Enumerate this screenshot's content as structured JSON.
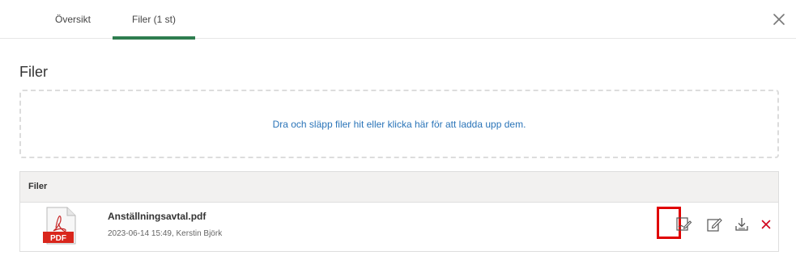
{
  "tabs": [
    {
      "label": "Översikt",
      "active": false
    },
    {
      "label": "Filer (1 st)",
      "active": true
    }
  ],
  "section": {
    "title": "Filer"
  },
  "dropzone": {
    "text": "Dra och släpp filer hit eller klicka här för att ladda upp dem."
  },
  "table": {
    "header": "Filer",
    "files": [
      {
        "name": "Anställningsavtal.pdf",
        "meta": "2023-06-14 15:49, Kerstin Björk",
        "type_badge": "PDF"
      }
    ]
  },
  "icons": {
    "close": "close-icon",
    "file": "pdf-file-icon",
    "sign": "sign-document-icon",
    "edit": "edit-icon",
    "download": "download-icon",
    "delete": "delete-icon"
  },
  "colors": {
    "accent_tab": "#2e7d4f",
    "link": "#2a74b8",
    "delete": "#d0021b",
    "highlight": "#e00000",
    "pdf_badge": "#d9261c"
  }
}
